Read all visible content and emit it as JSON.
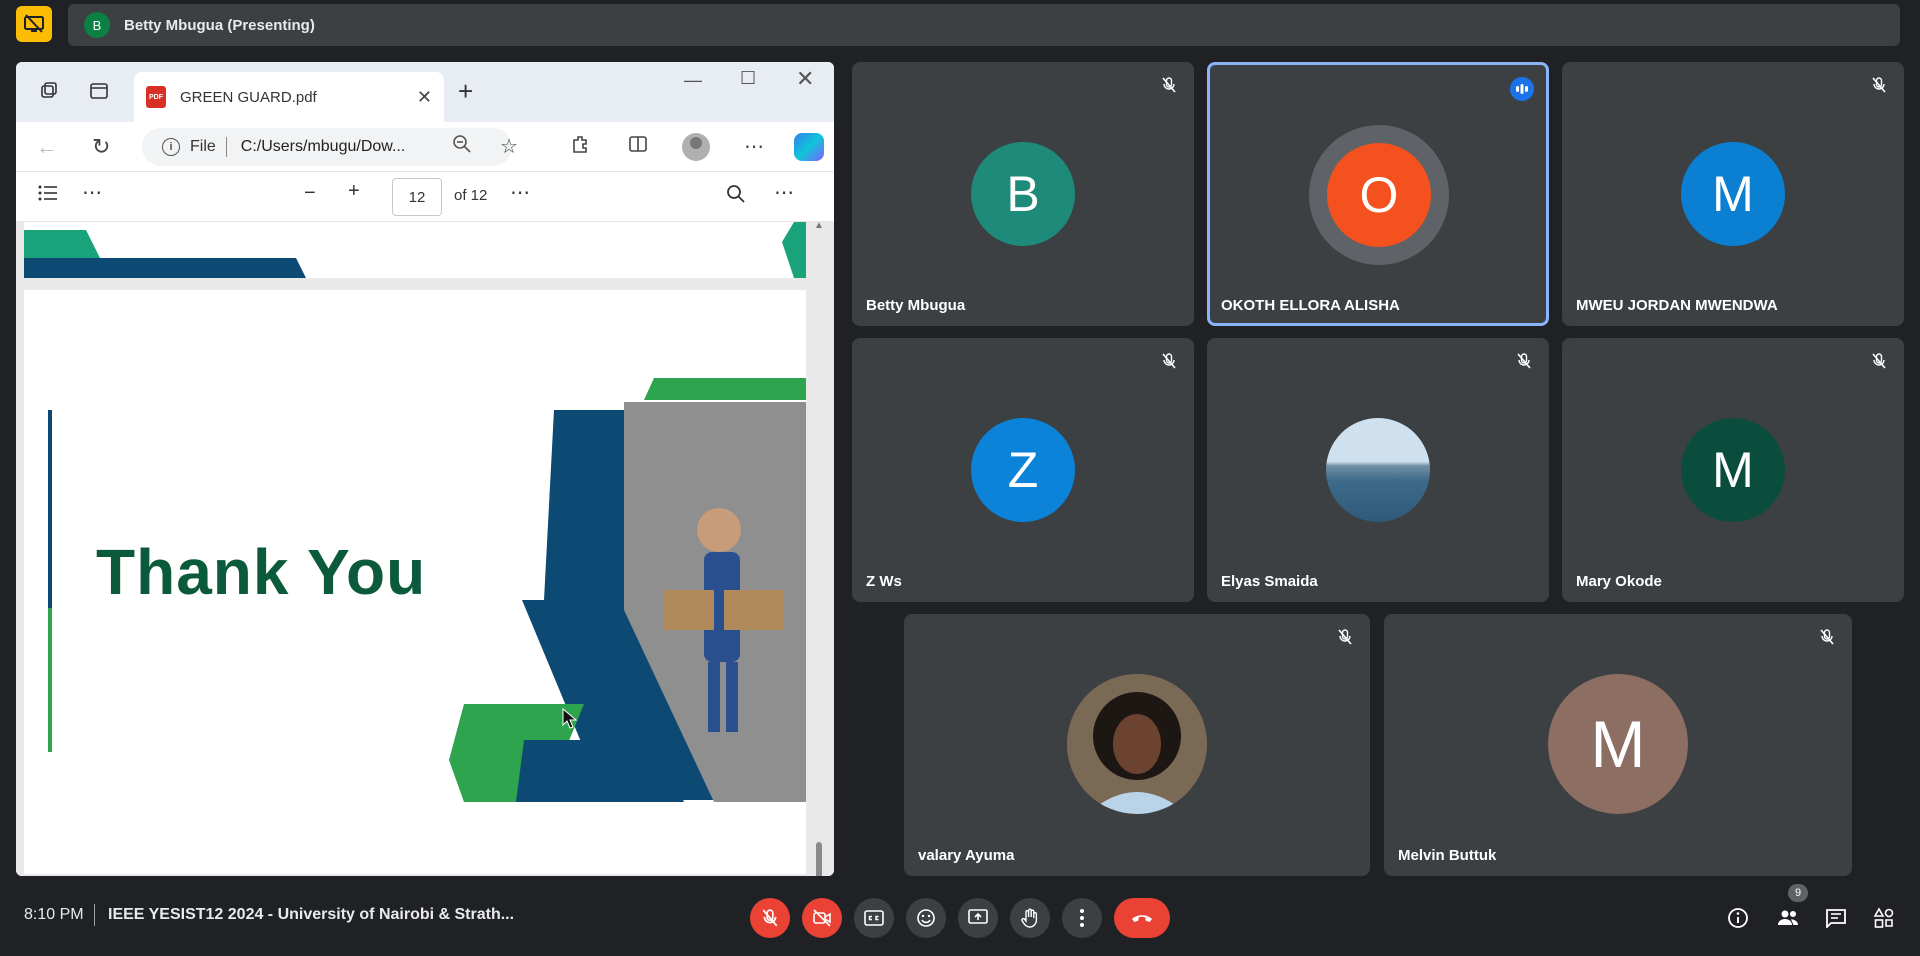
{
  "presenting": {
    "avatar_letter": "B",
    "text": "Betty Mbugua (Presenting)"
  },
  "browser": {
    "tab_title": "GREEN GUARD.pdf",
    "pdf_favicon": "PDF",
    "address_prefix": "File",
    "address_url": "C:/Users/mbugu/Dow...",
    "page_current": "12",
    "page_total": "of 12",
    "slide_text": "Thank You"
  },
  "participants": [
    {
      "name": "Betty Mbugua",
      "letter": "B",
      "color": "#1e8a7a",
      "muted": true
    },
    {
      "name": "OKOTH ELLORA ALISHA",
      "letter": "O",
      "color": "#f4511e",
      "muted": false,
      "speaking": true
    },
    {
      "name": "MWEU JORDAN MWENDWA",
      "letter": "M",
      "color": "#0b7fd1",
      "muted": true
    },
    {
      "name": "Z Ws",
      "letter": "Z",
      "color": "#0b83d9",
      "muted": true
    },
    {
      "name": "Elyas Smaida",
      "letter": "",
      "color": "#7fa6c8",
      "muted": true
    },
    {
      "name": "Mary Okode",
      "letter": "M",
      "color": "#0b4d3c",
      "muted": true
    },
    {
      "name": "valary Ayuma",
      "letter": "",
      "color": "#5a4a3a",
      "muted": true
    },
    {
      "name": "Melvin Buttuk",
      "letter": "M",
      "color": "#8d6e63",
      "muted": true
    }
  ],
  "bottom": {
    "time": "8:10 PM",
    "meeting_title": "IEEE YESIST12 2024 - University of Nairobi & Strath...",
    "participant_count": "9"
  },
  "icons": {
    "present": "present-stop-icon",
    "mic_off": "mic-off-icon",
    "cam_off": "camera-off-icon",
    "captions": "captions-icon",
    "emoji": "emoji-icon",
    "share": "present-screen-icon",
    "hand": "raise-hand-icon",
    "more": "more-vert-icon",
    "end": "end-call-icon",
    "info": "info-icon",
    "people": "people-icon",
    "chat": "chat-icon",
    "activities": "activities-icon"
  }
}
